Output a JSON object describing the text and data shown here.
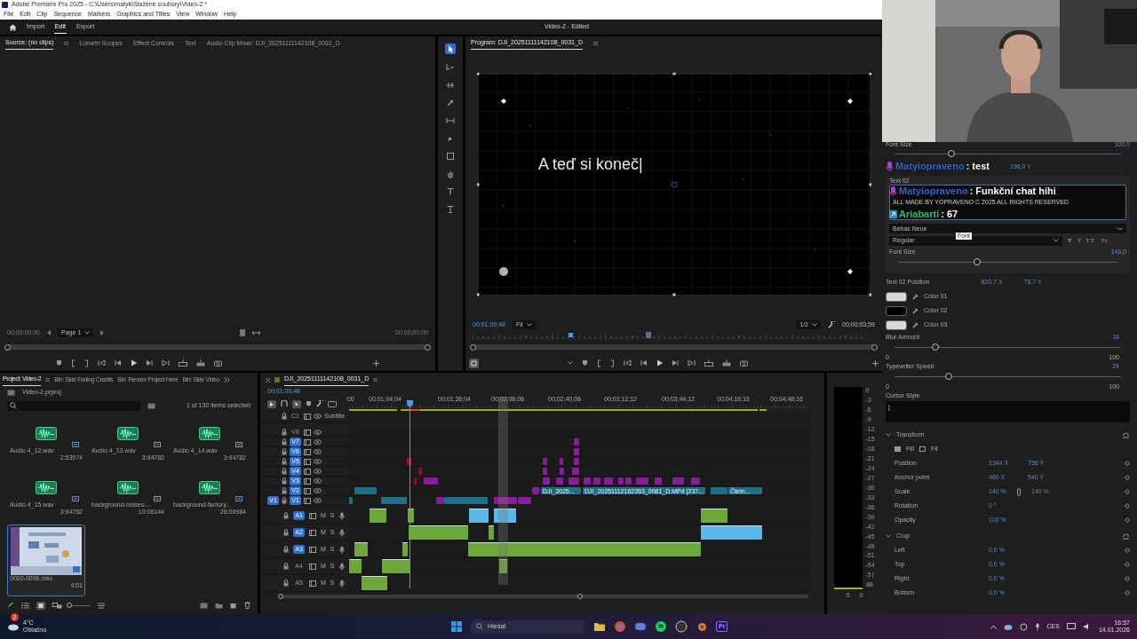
{
  "window": {
    "title": "Adobe Premiere Pro 2025 - C:\\Users\\matyk\\Stažené soubory\\Video-2 *"
  },
  "menu": [
    "File",
    "Edit",
    "Clip",
    "Sequence",
    "Markers",
    "Graphics and Titles",
    "View",
    "Window",
    "Help"
  ],
  "workspaces": [
    {
      "label": "Import",
      "selected": false
    },
    {
      "label": "Edit",
      "selected": true
    },
    {
      "label": "Export",
      "selected": false
    }
  ],
  "document_title": "Video-2 - Edited",
  "source_panel": {
    "tabs": [
      {
        "label": "Source: (no clips)",
        "selected": true
      },
      {
        "label": "Lumetri Scopes",
        "selected": false
      },
      {
        "label": "Effect Controls",
        "selected": false
      },
      {
        "label": "Text",
        "selected": false
      },
      {
        "label": "Audio Clip Mixer: DJI_20251111142108_0031_D",
        "selected": false
      }
    ],
    "timecode_in": "00;00;00;00",
    "page": "Page 1",
    "timecode_out": "00;00;00;00"
  },
  "program_panel": {
    "title": "Program: DJI_20251111142108_0031_D",
    "caption": "A teď si koneč|",
    "timecode": "00;01;09;48",
    "zoom": "Fit",
    "resolution": "1/2",
    "duration": "00;00;03;59"
  },
  "project_panel": {
    "tabs": [
      {
        "label": "Project: Video-2",
        "selected": true
      },
      {
        "label": "Bin: Side Fading Credits",
        "selected": false
      },
      {
        "label": "Bin: Render Project Here",
        "selected": false
      },
      {
        "label": "Bin: Side Video",
        "selected": false
      }
    ],
    "project_file": "Video-2.prproj",
    "thumbnail_zoom": {
      "level": 0.0
    },
    "selection_count": "1 of 130 items selected",
    "items": [
      {
        "kind": "audio",
        "name": "Audio 4_12.wav",
        "duration": "2:53974",
        "selected": false
      },
      {
        "kind": "audio",
        "name": "Audio 4_13.wav",
        "duration": "3:94782",
        "selected": false
      },
      {
        "kind": "audio",
        "name": "Audio 4_14.wav",
        "duration": "3:94782",
        "selected": false
      },
      {
        "kind": "audio",
        "name": "Audio 4_15.wav",
        "duration": "3:94782",
        "selected": false
      },
      {
        "kind": "audio",
        "name": "background-noises-...",
        "duration": "10:06144",
        "selected": false
      },
      {
        "kind": "audio",
        "name": "background-factory...",
        "duration": "26:09984",
        "selected": false
      },
      {
        "kind": "video",
        "name": "0000-0096.mkv",
        "duration": "4:01",
        "selected": true
      }
    ]
  },
  "timeline": {
    "sequence": "DJI_20251111142108_0031_D",
    "timecode": "00;01;09;48",
    "ruler": [
      ":00",
      "00;01;04;04",
      "00;01;36;04",
      "00;02;08;08",
      "00;02;40;08",
      "00;03;12;12",
      "00;03;44;12",
      "00;04;16;16",
      "00;04;48;16"
    ],
    "source_patch": "V1",
    "tracks": [
      {
        "kind": "caption",
        "label": "C1",
        "name": "Subtitle",
        "targeted": false
      },
      {
        "kind": "video",
        "label": "V8",
        "targeted": false
      },
      {
        "kind": "video",
        "label": "V7",
        "targeted": true
      },
      {
        "kind": "video",
        "label": "V6",
        "targeted": true
      },
      {
        "kind": "video",
        "label": "V5",
        "targeted": true
      },
      {
        "kind": "video",
        "label": "V4",
        "targeted": true
      },
      {
        "kind": "video",
        "label": "V3",
        "targeted": true
      },
      {
        "kind": "video",
        "label": "V2",
        "targeted": true
      },
      {
        "kind": "video",
        "label": "V1",
        "targeted": true
      },
      {
        "kind": "audio",
        "label": "A1",
        "targeted": true,
        "mute": "M",
        "solo": "S"
      },
      {
        "kind": "audio",
        "label": "A2",
        "targeted": true,
        "mute": "M",
        "solo": "S"
      },
      {
        "kind": "audio",
        "label": "A3",
        "targeted": true,
        "mute": "M",
        "solo": "S"
      },
      {
        "kind": "audio",
        "label": "A4",
        "targeted": false,
        "mute": "M",
        "solo": "S"
      },
      {
        "kind": "audio",
        "label": "A5",
        "targeted": false,
        "mute": "M",
        "solo": "S"
      }
    ],
    "clip_labels": [
      "DJI_2025...",
      "DJI_20251112162353_0061_D.MP4 [237...",
      "Čtetn..."
    ]
  },
  "audio_meter": {
    "scale": [
      "0",
      "-3",
      "-6",
      "-9",
      "-12",
      "-15",
      "-18",
      "-21",
      "-24",
      "-27",
      "-30",
      "-33",
      "-36",
      "-39",
      "-42",
      "-45",
      "-48",
      "-51",
      "-54",
      "-57",
      "dB"
    ],
    "channels": [
      "S",
      "S"
    ]
  },
  "essential_graphics": {
    "top_font_size": {
      "label": "Font Size",
      "value": "100,0",
      "level": 0.25
    },
    "text01_position_y": "196,0 Y",
    "text02": {
      "label": "Text 02",
      "value": "ALL MADE BY YOPRAVENO C 2025 ALL RIGHTS RESERVED",
      "font": "Bebas Neue",
      "style": "Regular",
      "tooltip": "Font",
      "style_buttons": [
        {
          "kind": "bold",
          "label": "T"
        },
        {
          "kind": "italic",
          "label": "T"
        },
        {
          "kind": "caps",
          "label": "TT"
        },
        {
          "kind": "smallcaps",
          "label": "Tт"
        }
      ],
      "font_size_label": "Font Size",
      "font_size": {
        "value": "146,0",
        "level": 0.36
      }
    },
    "text02_position": {
      "label": "Text 02 Position",
      "x": "820,7 X",
      "y": "78,7 Y"
    },
    "colors": [
      {
        "label": "Color 01",
        "color": "#d8d8d8"
      },
      {
        "label": "Color 02",
        "color": "#000000"
      },
      {
        "label": "Color 03",
        "color": "#d8d8d8"
      }
    ],
    "sliders": [
      {
        "label": "Blur Amount",
        "value": "18",
        "min": "0",
        "max": "100",
        "level": 0.18
      },
      {
        "label": "Typewriter Speed",
        "value": "24",
        "min": "0",
        "max": "100",
        "level": 0.24
      }
    ],
    "cursor_style": {
      "label": "Cursor Style",
      "value": "|"
    },
    "sections": [
      {
        "title": "Transform",
        "expanded": true,
        "fit_options": [
          "Fill",
          "Fit"
        ],
        "rows": [
          {
            "label": "Position",
            "value": "1344 X",
            "value2": "756 Y",
            "link": false
          },
          {
            "label": "Anchor point",
            "value": "960 X",
            "value2": "540 Y",
            "link": false
          },
          {
            "label": "Scale",
            "value": "140 %",
            "value2": "140 %",
            "link": true
          },
          {
            "label": "Rotation",
            "value": "0 °",
            "link": false
          },
          {
            "label": "Opacity",
            "value": "100 %",
            "link": false
          }
        ]
      },
      {
        "title": "Crop",
        "expanded": true,
        "rows": [
          {
            "label": "Left",
            "value": "0,0 %",
            "link": false
          },
          {
            "label": "Top",
            "value": "0,0 %",
            "link": false
          },
          {
            "label": "Right",
            "value": "0,0 %",
            "link": false
          },
          {
            "label": "Bottom",
            "value": "0,0 %",
            "link": false
          }
        ]
      }
    ]
  },
  "chat_overlay": [
    {
      "kind": "microphone",
      "user": "Matyiopraveno",
      "text": ": test",
      "color": "#2f66d0"
    },
    {
      "kind": "microphone",
      "user": "Matyiopraveno",
      "text": ": Funkční chat hihi",
      "color": "#2f66d0"
    },
    {
      "kind": "arrow",
      "user": "Ariabarti",
      "text": ": 67",
      "color": "#27c26a"
    }
  ],
  "taskbar": {
    "weather_badge": "2",
    "weather_temp": "4°C",
    "weather_text": "Oblačno",
    "search": "Hledat",
    "app_label": "Pr",
    "language": "CES",
    "time": "16:57",
    "date": "14.01.2026"
  }
}
